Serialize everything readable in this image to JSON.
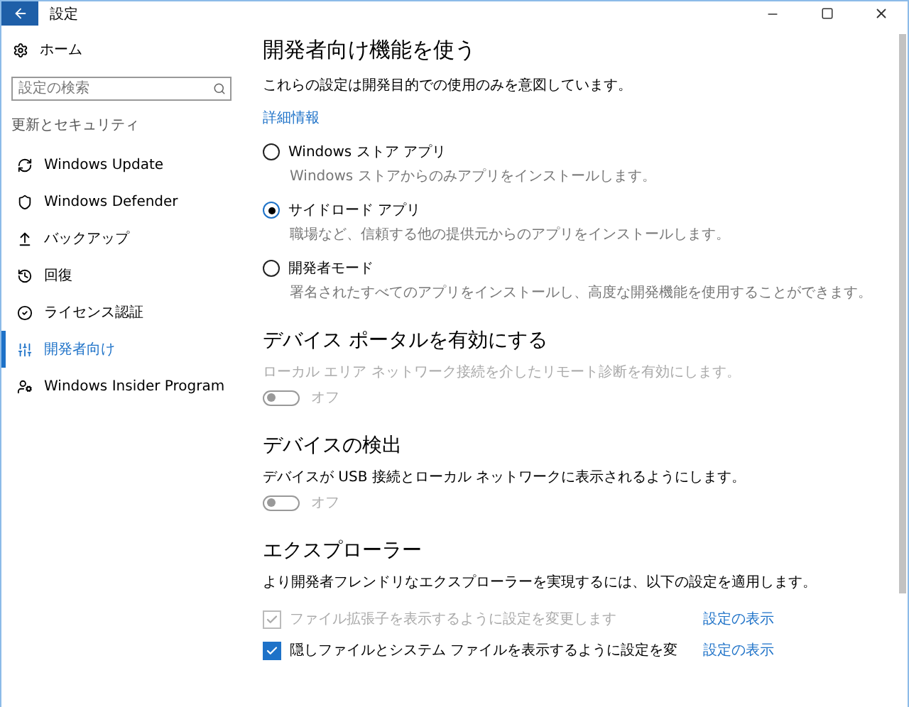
{
  "window": {
    "title": "設定"
  },
  "sidebar": {
    "home": "ホーム",
    "search": {
      "placeholder": "設定の検索"
    },
    "section": "更新とセキュリティ",
    "items": [
      {
        "label": "Windows Update",
        "selected": false
      },
      {
        "label": "Windows Defender",
        "selected": false
      },
      {
        "label": "バックアップ",
        "selected": false
      },
      {
        "label": "回復",
        "selected": false
      },
      {
        "label": "ライセンス認証",
        "selected": false
      },
      {
        "label": "開発者向け",
        "selected": true
      },
      {
        "label": "Windows Insider Program",
        "selected": false
      }
    ]
  },
  "main": {
    "title": "開発者向け機能を使う",
    "description": "これらの設定は開発目的での使用のみを意図しています。",
    "link": "詳細情報",
    "options": [
      {
        "label": "Windows ストア アプリ",
        "description": "Windows ストアからのみアプリをインストールします。",
        "selected": false
      },
      {
        "label": "サイドロード アプリ",
        "description": "職場など、信頼する他の提供元からのアプリをインストールします。",
        "selected": true
      },
      {
        "label": "開発者モード",
        "description": "署名されたすべてのアプリをインストールし、高度な開発機能を使用することができます。",
        "selected": false
      }
    ],
    "toggles": [
      {
        "title": "デバイス ポータルを有効にする",
        "description": "ローカル エリア ネットワーク接続を介したリモート診断を有効にします。",
        "disabled": true,
        "on": false,
        "state": "オフ"
      },
      {
        "title": "デバイスの検出",
        "description": "デバイスが USB 接続とローカル ネットワークに表示されるようにします。",
        "disabled": false,
        "on": false,
        "state": "オフ"
      }
    ],
    "explorer": {
      "title": "エクスプローラー",
      "description": "より開発者フレンドリなエクスプローラーを実現するには、以下の設定を適用します。",
      "rows": [
        {
          "label": "ファイル拡張子を表示するように設定を変更します",
          "checked": true,
          "disabled": true,
          "link": "設定の表示"
        },
        {
          "label": "隠しファイルとシステム ファイルを表示するように設定を変",
          "checked": true,
          "disabled": false,
          "link": "設定の表示"
        }
      ]
    }
  }
}
